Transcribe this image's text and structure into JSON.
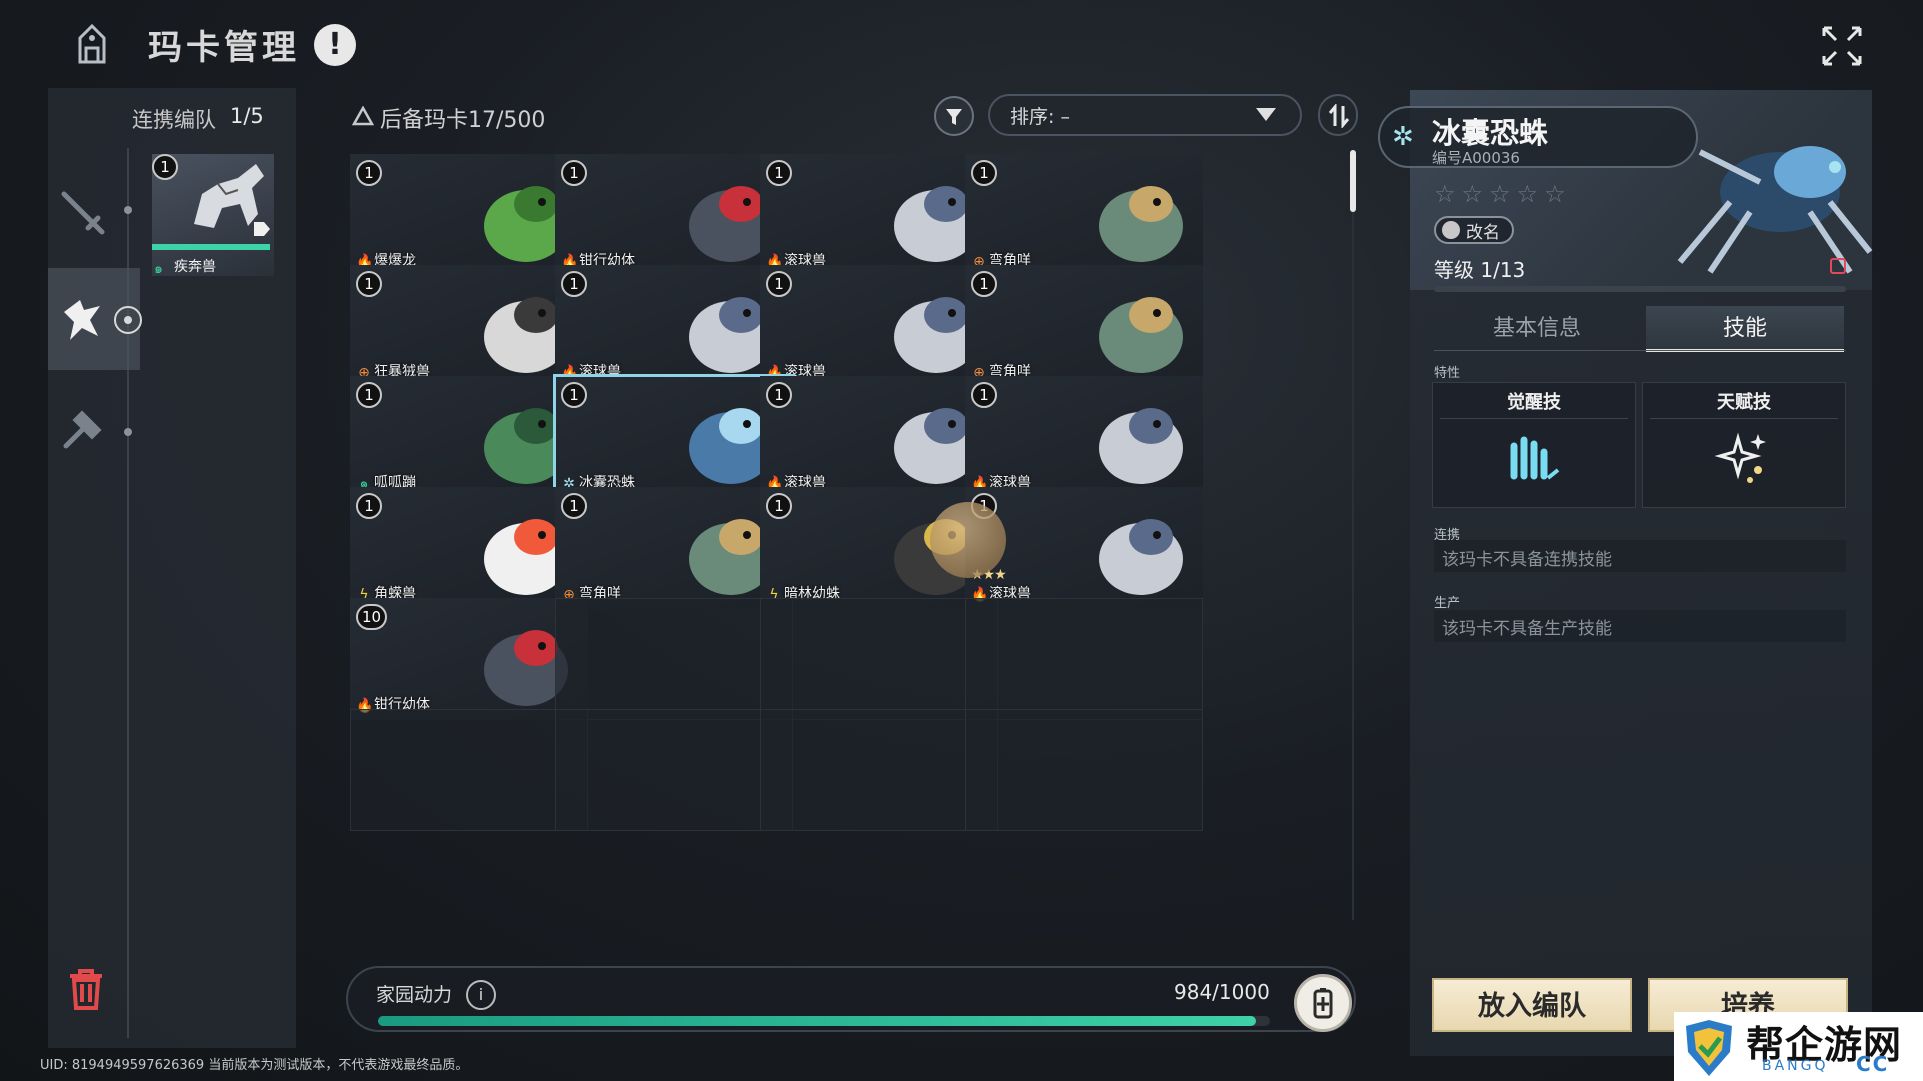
{
  "header": {
    "title": "玛卡管理",
    "alert": "!"
  },
  "team": {
    "label": "连携编队",
    "count": "1/5",
    "member": {
      "count": "1",
      "name": "疾奔兽",
      "element": "wind",
      "hp_fraction": 1.0
    }
  },
  "reserve": {
    "label": "后备玛卡",
    "count": "17/500"
  },
  "sort": {
    "label": "排序: –"
  },
  "cards": [
    {
      "count": "1",
      "name": "爆爆龙",
      "element": "fire",
      "element_icon": "flame",
      "art": "green-dino"
    },
    {
      "count": "1",
      "name": "钳行幼体",
      "element": "fire",
      "element_icon": "flame",
      "art": "mech-crab"
    },
    {
      "count": "1",
      "name": "滚球兽",
      "element": "fire",
      "element_icon": "flame",
      "art": "round-mouse"
    },
    {
      "count": "1",
      "name": "弯角咩",
      "element": "light",
      "element_icon": "cross-circle",
      "art": "horned-goat"
    },
    {
      "count": "1",
      "name": "狂暴狨兽",
      "element": "light",
      "element_icon": "cross-circle",
      "art": "mech-monkey"
    },
    {
      "count": "1",
      "name": "滚球兽",
      "element": "fire",
      "element_icon": "flame",
      "art": "round-mouse"
    },
    {
      "count": "1",
      "name": "滚球兽",
      "element": "fire",
      "element_icon": "flame",
      "art": "round-mouse"
    },
    {
      "count": "1",
      "name": "弯角咩",
      "element": "light",
      "element_icon": "cross-circle",
      "art": "horned-goat"
    },
    {
      "count": "1",
      "name": "呱呱蹦",
      "element": "wind",
      "element_icon": "swirl",
      "art": "frog"
    },
    {
      "count": "1",
      "name": "冰囊恐蛛",
      "element": "ice",
      "element_icon": "snowflake",
      "art": "ice-spider",
      "selected": true
    },
    {
      "count": "1",
      "name": "滚球兽",
      "element": "fire",
      "element_icon": "flame",
      "art": "round-mouse"
    },
    {
      "count": "1",
      "name": "滚球兽",
      "element": "fire",
      "element_icon": "flame",
      "art": "round-mouse"
    },
    {
      "count": "1",
      "name": "角蝾兽",
      "element": "electric",
      "element_icon": "bolt",
      "art": "axolotl"
    },
    {
      "count": "1",
      "name": "弯角咩",
      "element": "light",
      "element_icon": "cross-circle",
      "art": "horned-goat"
    },
    {
      "count": "1",
      "name": "暗林幼蛛",
      "element": "electric",
      "element_icon": "bolt",
      "art": "gold-spider"
    },
    {
      "count": "1",
      "name": "滚球兽",
      "element": "fire",
      "element_icon": "flame",
      "art": "round-mouse",
      "stars": "★★★"
    },
    {
      "count": "10",
      "name": "钳行幼体",
      "element": "fire",
      "element_icon": "flame",
      "art": "mech-crab"
    }
  ],
  "energy": {
    "label": "家园动力",
    "value": "984/1000",
    "fraction": 0.984
  },
  "uid": "UID: 8194949597626369 当前版本为测试版本，不代表游戏最终品质。",
  "detail": {
    "name": "冰囊恐蛛",
    "id": "编号A00036",
    "stars": "☆☆☆☆☆",
    "rename": "改名",
    "level": "等级 1/13",
    "tabs": {
      "basic": "基本信息",
      "skill": "技能"
    },
    "trait_label": "特性",
    "awaken_label": "觉醒技",
    "talent_label": "天赋技",
    "link_label": "连携",
    "link_empty": "该玛卡不具备连携技能",
    "prod_label": "生产",
    "prod_empty": "该玛卡不具备生产技能",
    "btn_team": "放入编队",
    "btn_train": "培养"
  },
  "watermark": {
    "text": "帮企游网",
    "sub": "BANGQ",
    "sub2": "CC"
  },
  "colors": {
    "fire": "#f26a3a",
    "light": "#f28a3a",
    "wind": "#3ad29a",
    "ice": "#a8e4f0",
    "electric": "#f2d23a",
    "energy": "#3ed2a8",
    "selected": "#8fd4e8"
  }
}
